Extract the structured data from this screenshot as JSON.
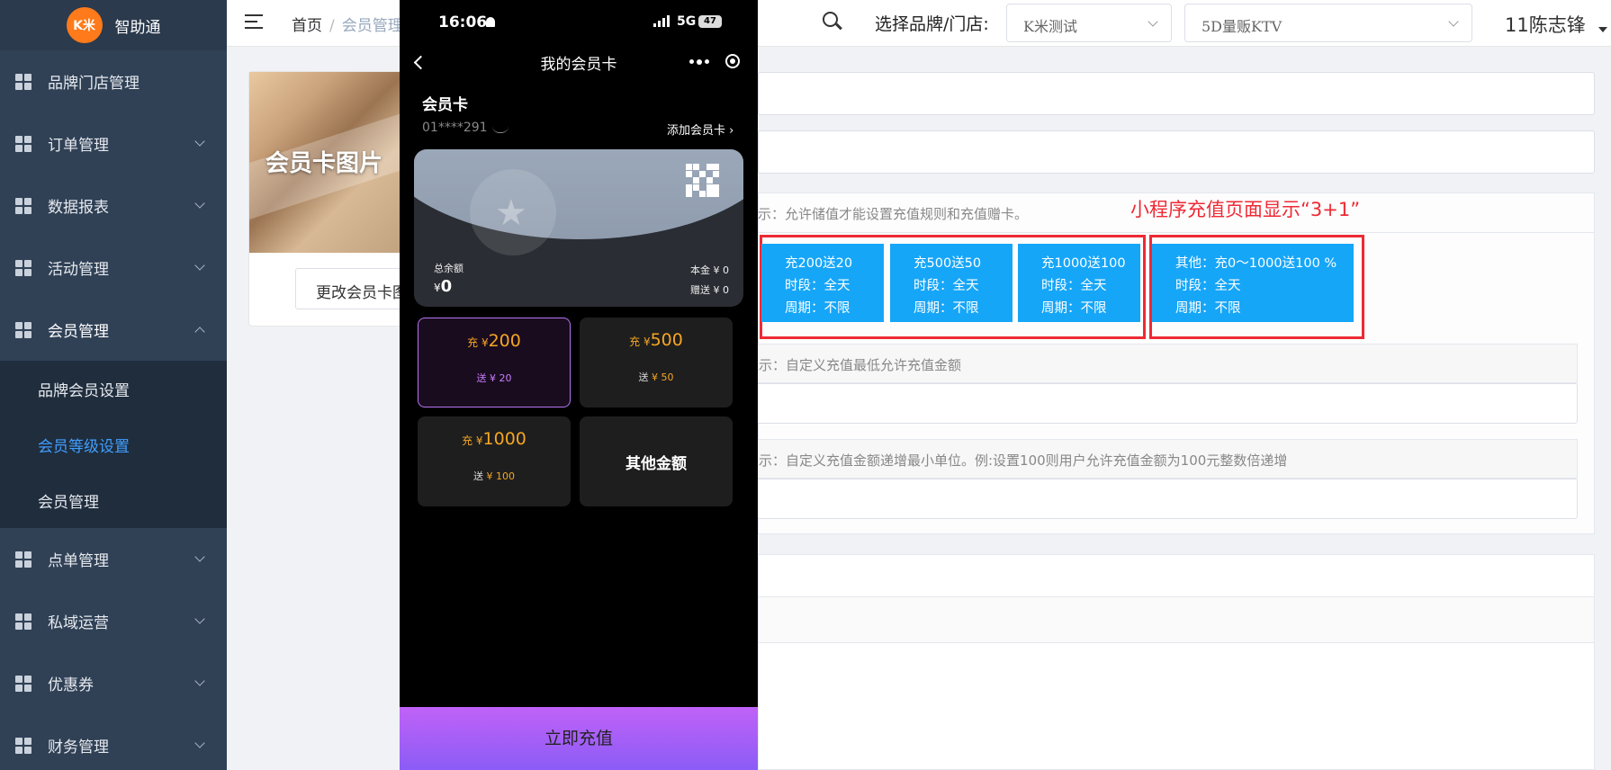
{
  "sidebar": {
    "logo_text": "K米",
    "app_name": "智助通",
    "items": [
      {
        "label": "品牌门店管理"
      },
      {
        "label": "订单管理"
      },
      {
        "label": "数据报表"
      },
      {
        "label": "活动管理"
      },
      {
        "label": "会员管理"
      },
      {
        "label": "点单管理"
      },
      {
        "label": "私域运营"
      },
      {
        "label": "优惠券"
      },
      {
        "label": "财务管理"
      }
    ],
    "submenu": [
      {
        "label": "品牌会员设置"
      },
      {
        "label": "会员等级设置",
        "active": true
      },
      {
        "label": "会员管理"
      }
    ]
  },
  "header": {
    "breadcrumb_home": "首页",
    "breadcrumb_separator": "/",
    "breadcrumb_current": "会员管理",
    "store_label": "选择品牌/门店:",
    "brand_select": "K米测试",
    "store_select": "5D量贩KTV",
    "user_name": "11陈志锋"
  },
  "card_panel": {
    "image_text": "会员卡图片",
    "change_button": "更改会员卡图片"
  },
  "form": {
    "tip_store_value": "示：允许储值才能设置充值规则和充值赠卡。",
    "annotation": "小程序充值页面显示“3+1”",
    "rules": [
      {
        "title": "充200送20",
        "period": "时段：全天",
        "cycle": "周期：不限"
      },
      {
        "title": "充500送50",
        "period": "时段：全天",
        "cycle": "周期：不限"
      },
      {
        "title": "充1000送100",
        "period": "时段：全天",
        "cycle": "周期：不限"
      },
      {
        "title": "其他：充0～1000送100 %",
        "period": "时段：全天",
        "cycle": "周期：不限"
      }
    ],
    "tip_min_amount": "提示：自定义充值最低允许充值金额",
    "tip_increment": "提示：自定义充值金额递增最小单位。例:设置100则用户允许充值金额为100元整数倍递增"
  },
  "phone": {
    "time": "16:06",
    "network": "5G",
    "battery": "47",
    "nav_title": "我的会员卡",
    "card_section_title": "会员卡",
    "card_number": "01****291",
    "add_card": "添加会员卡",
    "balance_label": "总余额",
    "balance_currency": "¥",
    "balance_value": "0",
    "principal": "本金 ¥ 0",
    "gift": "赠送 ¥ 0",
    "options": [
      {
        "prefix": "充 ¥",
        "amount": "200",
        "bonus_prefix": "送",
        "bonus": "¥ 20",
        "selected": true
      },
      {
        "prefix": "充 ¥",
        "amount": "500",
        "bonus_prefix": "送",
        "bonus": "¥ 50"
      },
      {
        "prefix": "充 ¥",
        "amount": "1000",
        "bonus_prefix": "送",
        "bonus": "¥ 100"
      },
      {
        "label": "其他金额"
      }
    ],
    "recharge_button": "立即充值",
    "colors": {
      "accent": "#b676f2",
      "amount": "#f5a623",
      "button": "#a55ff7"
    }
  }
}
